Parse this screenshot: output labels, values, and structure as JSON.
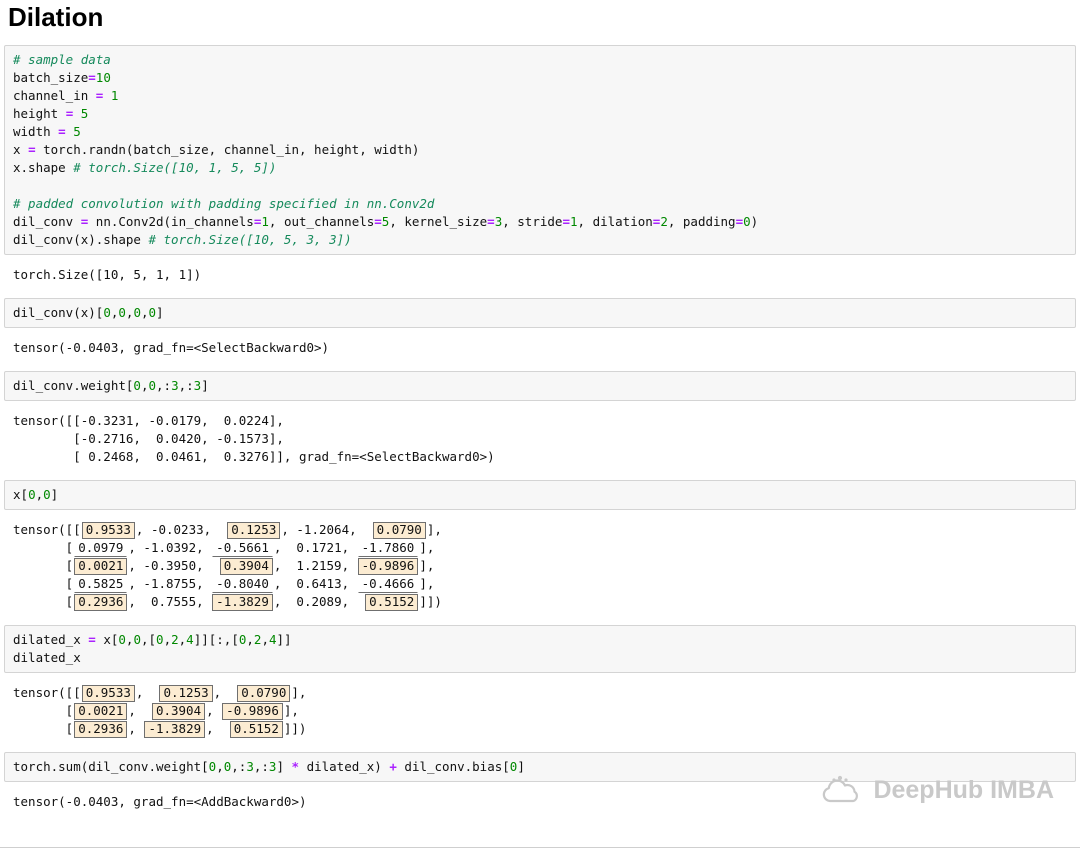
{
  "page": {
    "title": "Dilation"
  },
  "watermark": {
    "text": "DeepHub IMBA"
  },
  "colors": {
    "code_bg": "#f7f7f7",
    "code_border": "#d4d4d4",
    "comment": "#168a5c",
    "number": "#008800",
    "operator": "#AA22FF",
    "highlight_fill": "#fcecd2",
    "highlight_border": "#6f6f6f",
    "watermark": "#c9c9c9"
  },
  "cells": [
    {
      "kind": "code",
      "name": "code-cell-setup",
      "lines": [
        [
          {
            "c": "cm",
            "t": "# sample data"
          }
        ],
        [
          {
            "c": "pl",
            "t": "batch_size"
          },
          {
            "c": "op",
            "t": "="
          },
          {
            "c": "num",
            "t": "10"
          }
        ],
        [
          {
            "c": "pl",
            "t": "channel_in "
          },
          {
            "c": "op",
            "t": "="
          },
          {
            "c": "pl",
            "t": " "
          },
          {
            "c": "num",
            "t": "1"
          }
        ],
        [
          {
            "c": "pl",
            "t": "height "
          },
          {
            "c": "op",
            "t": "="
          },
          {
            "c": "pl",
            "t": " "
          },
          {
            "c": "num",
            "t": "5"
          }
        ],
        [
          {
            "c": "pl",
            "t": "width "
          },
          {
            "c": "op",
            "t": "="
          },
          {
            "c": "pl",
            "t": " "
          },
          {
            "c": "num",
            "t": "5"
          }
        ],
        [
          {
            "c": "pl",
            "t": "x "
          },
          {
            "c": "op",
            "t": "="
          },
          {
            "c": "pl",
            "t": " torch.randn(batch_size, channel_in, height, width)"
          }
        ],
        [
          {
            "c": "pl",
            "t": "x.shape "
          },
          {
            "c": "cm",
            "t": "# torch.Size([10, 1, 5, 5])"
          }
        ],
        [],
        [
          {
            "c": "cm",
            "t": "# padded convolution with padding specified in nn.Conv2d"
          }
        ],
        [
          {
            "c": "pl",
            "t": "dil_conv "
          },
          {
            "c": "op",
            "t": "="
          },
          {
            "c": "pl",
            "t": " nn.Conv2d(in_channels"
          },
          {
            "c": "op",
            "t": "="
          },
          {
            "c": "num",
            "t": "1"
          },
          {
            "c": "pl",
            "t": ", out_channels"
          },
          {
            "c": "op",
            "t": "="
          },
          {
            "c": "num",
            "t": "5"
          },
          {
            "c": "pl",
            "t": ", kernel_size"
          },
          {
            "c": "op",
            "t": "="
          },
          {
            "c": "num",
            "t": "3"
          },
          {
            "c": "pl",
            "t": ", stride"
          },
          {
            "c": "op",
            "t": "="
          },
          {
            "c": "num",
            "t": "1"
          },
          {
            "c": "pl",
            "t": ", dilation"
          },
          {
            "c": "op",
            "t": "="
          },
          {
            "c": "num",
            "t": "2"
          },
          {
            "c": "pl",
            "t": ", padding"
          },
          {
            "c": "op",
            "t": "="
          },
          {
            "c": "num",
            "t": "0"
          },
          {
            "c": "pl",
            "t": ")"
          }
        ],
        [
          {
            "c": "pl",
            "t": "dil_conv(x).shape "
          },
          {
            "c": "cm",
            "t": "# torch.Size([10, 5, 3, 3])"
          }
        ]
      ]
    },
    {
      "kind": "output",
      "name": "output-conv-shape",
      "lines": [
        [
          {
            "c": "pl",
            "t": "torch.Size([10, 5, 1, 1])"
          }
        ]
      ]
    },
    {
      "kind": "code",
      "name": "code-cell-dilconv-value",
      "lines": [
        [
          {
            "c": "pl",
            "t": "dil_conv(x)["
          },
          {
            "c": "num",
            "t": "0"
          },
          {
            "c": "pl",
            "t": ","
          },
          {
            "c": "num",
            "t": "0"
          },
          {
            "c": "pl",
            "t": ","
          },
          {
            "c": "num",
            "t": "0"
          },
          {
            "c": "pl",
            "t": ","
          },
          {
            "c": "num",
            "t": "0"
          },
          {
            "c": "pl",
            "t": "]"
          }
        ]
      ]
    },
    {
      "kind": "output",
      "name": "output-dilconv-value",
      "lines": [
        [
          {
            "c": "pl",
            "t": "tensor(-0.0403, grad_fn=<SelectBackward0>)"
          }
        ]
      ]
    },
    {
      "kind": "code",
      "name": "code-cell-weight",
      "lines": [
        [
          {
            "c": "pl",
            "t": "dil_conv.weight["
          },
          {
            "c": "num",
            "t": "0"
          },
          {
            "c": "pl",
            "t": ","
          },
          {
            "c": "num",
            "t": "0"
          },
          {
            "c": "pl",
            "t": ",:"
          },
          {
            "c": "num",
            "t": "3"
          },
          {
            "c": "pl",
            "t": ",:"
          },
          {
            "c": "num",
            "t": "3"
          },
          {
            "c": "pl",
            "t": "]"
          }
        ]
      ]
    },
    {
      "kind": "output",
      "name": "output-weight",
      "lines": [
        [
          {
            "c": "pl",
            "t": "tensor([[-0.3231, -0.0179,  0.0224],"
          }
        ],
        [
          {
            "c": "pl",
            "t": "        [-0.2716,  0.0420, -0.1573],"
          }
        ],
        [
          {
            "c": "pl",
            "t": "        [ 0.2468,  0.0461,  0.3276]], grad_fn=<SelectBackward0>)"
          }
        ]
      ]
    },
    {
      "kind": "code",
      "name": "code-cell-x",
      "lines": [
        [
          {
            "c": "pl",
            "t": "x["
          },
          {
            "c": "num",
            "t": "0"
          },
          {
            "c": "pl",
            "t": ","
          },
          {
            "c": "num",
            "t": "0"
          },
          {
            "c": "pl",
            "t": "]"
          }
        ]
      ]
    },
    {
      "kind": "output",
      "name": "output-x-highlighted",
      "lines": [
        [
          {
            "c": "pl",
            "t": "tensor([["
          },
          {
            "c": "box",
            "t": "0.9533"
          },
          {
            "c": "pl",
            "t": ", -0.0233,  "
          },
          {
            "c": "box",
            "t": "0.1253"
          },
          {
            "c": "pl",
            "t": ", -1.2064,  "
          },
          {
            "c": "box",
            "t": "0.0790"
          },
          {
            "c": "pl",
            "t": "],"
          }
        ],
        [
          {
            "c": "pl",
            "t": "       ["
          },
          {
            "c": "ul",
            "t": "0.0979"
          },
          {
            "c": "pl",
            "t": ", -1.0392, "
          },
          {
            "c": "ul",
            "t": "-0.5661"
          },
          {
            "c": "pl",
            "t": ",  0.1721, "
          },
          {
            "c": "ul",
            "t": "-1.7860"
          },
          {
            "c": "pl",
            "t": "],"
          }
        ],
        [
          {
            "c": "pl",
            "t": "       ["
          },
          {
            "c": "box",
            "t": "0.0021"
          },
          {
            "c": "pl",
            "t": ", -0.3950,  "
          },
          {
            "c": "box",
            "t": "0.3904"
          },
          {
            "c": "pl",
            "t": ",  1.2159, "
          },
          {
            "c": "box",
            "t": "-0.9896"
          },
          {
            "c": "pl",
            "t": "],"
          }
        ],
        [
          {
            "c": "pl",
            "t": "       ["
          },
          {
            "c": "ul",
            "t": "0.5825"
          },
          {
            "c": "pl",
            "t": ", -1.8755, "
          },
          {
            "c": "ul",
            "t": "-0.8040"
          },
          {
            "c": "pl",
            "t": ",  0.6413, "
          },
          {
            "c": "ul",
            "t": "-0.4666"
          },
          {
            "c": "pl",
            "t": "],"
          }
        ],
        [
          {
            "c": "pl",
            "t": "       ["
          },
          {
            "c": "box",
            "t": "0.2936"
          },
          {
            "c": "pl",
            "t": ",  0.7555, "
          },
          {
            "c": "box",
            "t": "-1.3829"
          },
          {
            "c": "pl",
            "t": ",  0.2089,  "
          },
          {
            "c": "box",
            "t": "0.5152"
          },
          {
            "c": "pl",
            "t": "]])"
          }
        ]
      ]
    },
    {
      "kind": "code",
      "name": "code-cell-dilated-x",
      "lines": [
        [
          {
            "c": "pl",
            "t": "dilated_x "
          },
          {
            "c": "op",
            "t": "="
          },
          {
            "c": "pl",
            "t": " x["
          },
          {
            "c": "num",
            "t": "0"
          },
          {
            "c": "pl",
            "t": ","
          },
          {
            "c": "num",
            "t": "0"
          },
          {
            "c": "pl",
            "t": ",["
          },
          {
            "c": "num",
            "t": "0"
          },
          {
            "c": "pl",
            "t": ","
          },
          {
            "c": "num",
            "t": "2"
          },
          {
            "c": "pl",
            "t": ","
          },
          {
            "c": "num",
            "t": "4"
          },
          {
            "c": "pl",
            "t": "]][:,["
          },
          {
            "c": "num",
            "t": "0"
          },
          {
            "c": "pl",
            "t": ","
          },
          {
            "c": "num",
            "t": "2"
          },
          {
            "c": "pl",
            "t": ","
          },
          {
            "c": "num",
            "t": "4"
          },
          {
            "c": "pl",
            "t": "]]"
          }
        ],
        [
          {
            "c": "pl",
            "t": "dilated_x"
          }
        ]
      ]
    },
    {
      "kind": "output",
      "name": "output-dilated-x",
      "lines": [
        [
          {
            "c": "pl",
            "t": "tensor([["
          },
          {
            "c": "box",
            "t": "0.9533"
          },
          {
            "c": "pl",
            "t": ",  "
          },
          {
            "c": "box",
            "t": "0.1253"
          },
          {
            "c": "pl",
            "t": ",  "
          },
          {
            "c": "box",
            "t": "0.0790"
          },
          {
            "c": "pl",
            "t": "],"
          }
        ],
        [
          {
            "c": "pl",
            "t": "       ["
          },
          {
            "c": "box",
            "t": "0.0021"
          },
          {
            "c": "pl",
            "t": ",  "
          },
          {
            "c": "box",
            "t": "0.3904"
          },
          {
            "c": "pl",
            "t": ", "
          },
          {
            "c": "box",
            "t": "-0.9896"
          },
          {
            "c": "pl",
            "t": "],"
          }
        ],
        [
          {
            "c": "pl",
            "t": "       ["
          },
          {
            "c": "box",
            "t": "0.2936"
          },
          {
            "c": "pl",
            "t": ", "
          },
          {
            "c": "box",
            "t": "-1.3829"
          },
          {
            "c": "pl",
            "t": ",  "
          },
          {
            "c": "box",
            "t": "0.5152"
          },
          {
            "c": "pl",
            "t": "]])"
          }
        ]
      ]
    },
    {
      "kind": "code",
      "name": "code-cell-manual-sum",
      "lines": [
        [
          {
            "c": "pl",
            "t": "torch.sum(dil_conv.weight["
          },
          {
            "c": "num",
            "t": "0"
          },
          {
            "c": "pl",
            "t": ","
          },
          {
            "c": "num",
            "t": "0"
          },
          {
            "c": "pl",
            "t": ",:"
          },
          {
            "c": "num",
            "t": "3"
          },
          {
            "c": "pl",
            "t": ",:"
          },
          {
            "c": "num",
            "t": "3"
          },
          {
            "c": "pl",
            "t": "] "
          },
          {
            "c": "op",
            "t": "*"
          },
          {
            "c": "pl",
            "t": " dilated_x) "
          },
          {
            "c": "op",
            "t": "+"
          },
          {
            "c": "pl",
            "t": " dil_conv.bias["
          },
          {
            "c": "num",
            "t": "0"
          },
          {
            "c": "pl",
            "t": "]"
          }
        ]
      ]
    },
    {
      "kind": "output",
      "name": "output-manual-sum",
      "lines": [
        [
          {
            "c": "pl",
            "t": "tensor(-0.0403, grad_fn=<AddBackward0>)"
          }
        ]
      ]
    }
  ]
}
